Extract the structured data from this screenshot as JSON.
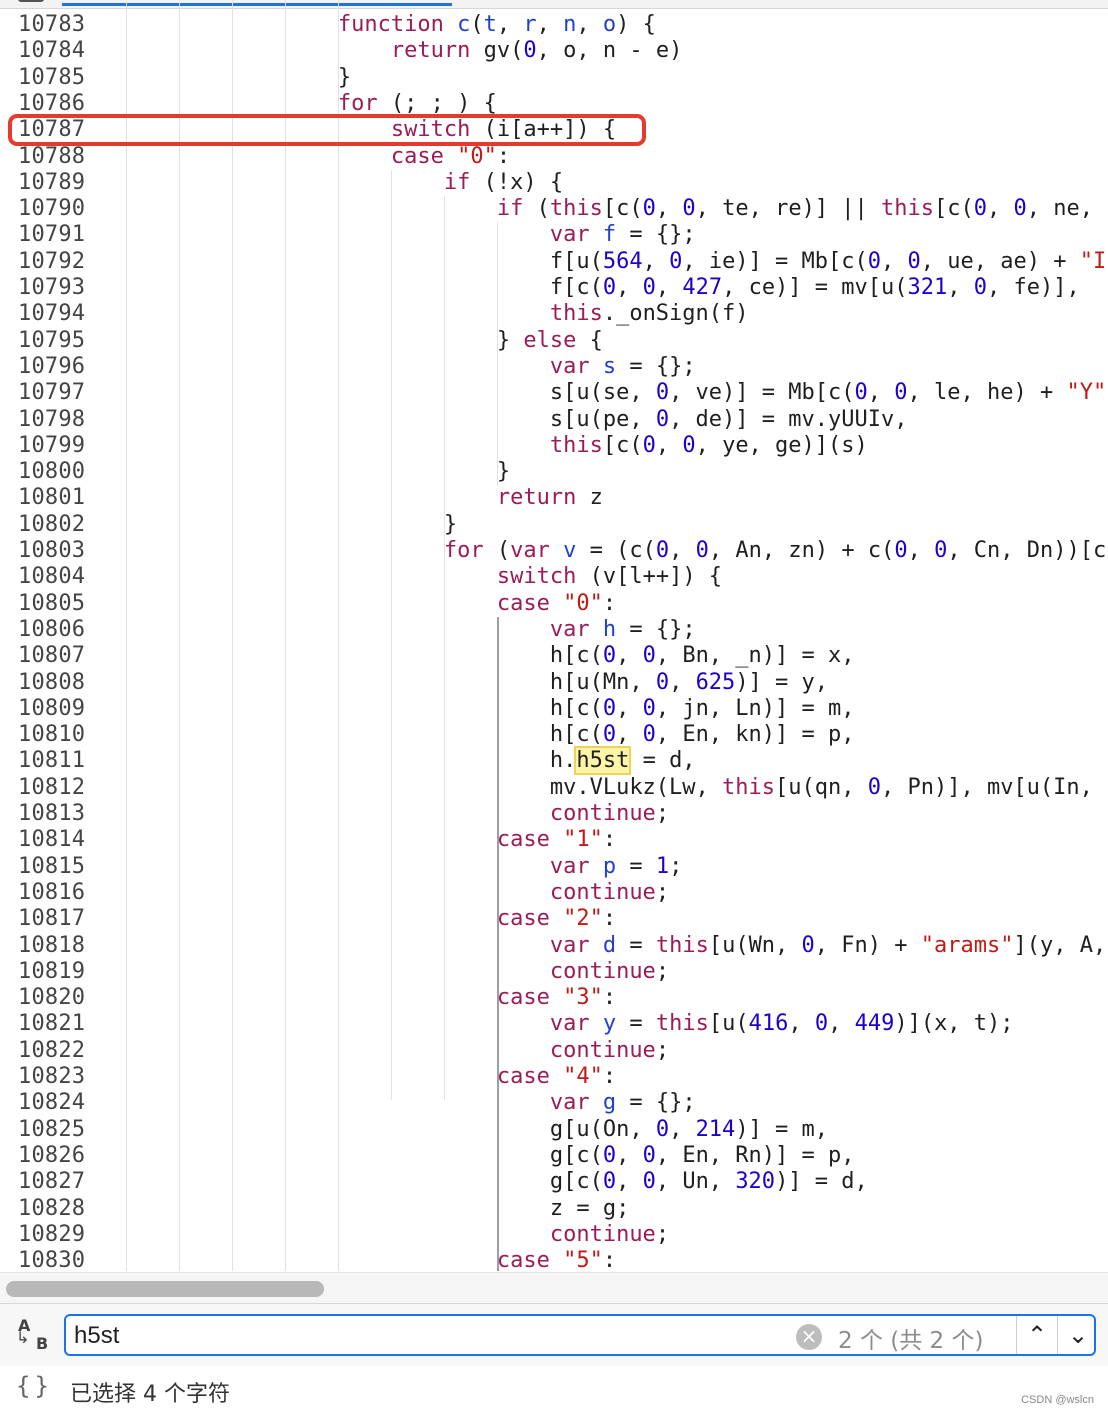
{
  "code_lines": [
    {
      "n": "10783",
      "segs": [
        [
          "                ",
          ""
        ],
        [
          "function",
          "kw2"
        ],
        [
          " ",
          ""
        ],
        [
          "c",
          "vn"
        ],
        [
          "(",
          ""
        ],
        [
          "t",
          "vn"
        ],
        [
          ", ",
          ""
        ],
        [
          "r",
          "vn"
        ],
        [
          ", ",
          ""
        ],
        [
          "n",
          "vn"
        ],
        [
          ", ",
          ""
        ],
        [
          "o",
          "vn"
        ],
        [
          ") {",
          ""
        ]
      ]
    },
    {
      "n": "10784",
      "segs": [
        [
          "                    ",
          ""
        ],
        [
          "return",
          "kw2"
        ],
        [
          " gv(",
          ""
        ],
        [
          "0",
          "num"
        ],
        [
          ", o, n - e)",
          ""
        ]
      ]
    },
    {
      "n": "10785",
      "segs": [
        [
          "                }",
          ""
        ]
      ]
    },
    {
      "n": "10786",
      "segs": [
        [
          "                ",
          ""
        ],
        [
          "for",
          "kw2"
        ],
        [
          " (; ; ) {",
          ""
        ]
      ]
    },
    {
      "n": "10787",
      "segs": [
        [
          "                    ",
          ""
        ],
        [
          "switch",
          "kw2"
        ],
        [
          " (i[a++]) {",
          ""
        ]
      ]
    },
    {
      "n": "10788",
      "segs": [
        [
          "                    ",
          ""
        ],
        [
          "case",
          "kw2"
        ],
        [
          " ",
          ""
        ],
        [
          "\"0\"",
          "str"
        ],
        [
          ":",
          ""
        ]
      ]
    },
    {
      "n": "10789",
      "segs": [
        [
          "                        ",
          ""
        ],
        [
          "if",
          "kw2"
        ],
        [
          " (!x) {",
          ""
        ]
      ]
    },
    {
      "n": "10790",
      "segs": [
        [
          "                            ",
          ""
        ],
        [
          "if",
          "kw2"
        ],
        [
          " (",
          ""
        ],
        [
          "this",
          "kw2"
        ],
        [
          "[c(",
          ""
        ],
        [
          "0",
          "num"
        ],
        [
          ", ",
          ""
        ],
        [
          "0",
          "num"
        ],
        [
          ", te, re)] || ",
          ""
        ],
        [
          "this",
          "kw2"
        ],
        [
          "[c(",
          ""
        ],
        [
          "0",
          "num"
        ],
        [
          ", ",
          ""
        ],
        [
          "0",
          "num"
        ],
        [
          ", ne,",
          ""
        ]
      ]
    },
    {
      "n": "10791",
      "segs": [
        [
          "                                ",
          ""
        ],
        [
          "var",
          "kw2"
        ],
        [
          " ",
          ""
        ],
        [
          "f",
          "vn"
        ],
        [
          " = {};",
          ""
        ]
      ]
    },
    {
      "n": "10792",
      "segs": [
        [
          "                                f[u(",
          ""
        ],
        [
          "564",
          "num"
        ],
        [
          ", ",
          ""
        ],
        [
          "0",
          "num"
        ],
        [
          ", ie)] = Mb[c(",
          ""
        ],
        [
          "0",
          "num"
        ],
        [
          ", ",
          ""
        ],
        [
          "0",
          "num"
        ],
        [
          ", ue, ae) + ",
          ""
        ],
        [
          "\"I",
          "str"
        ]
      ]
    },
    {
      "n": "10793",
      "segs": [
        [
          "                                f[c(",
          ""
        ],
        [
          "0",
          "num"
        ],
        [
          ", ",
          ""
        ],
        [
          "0",
          "num"
        ],
        [
          ", ",
          ""
        ],
        [
          "427",
          "num"
        ],
        [
          ", ce)] = mv[u(",
          ""
        ],
        [
          "321",
          "num"
        ],
        [
          ", ",
          ""
        ],
        [
          "0",
          "num"
        ],
        [
          ", fe)],",
          ""
        ]
      ]
    },
    {
      "n": "10794",
      "segs": [
        [
          "                                ",
          ""
        ],
        [
          "this",
          "kw2"
        ],
        [
          "._onSign(f)",
          ""
        ]
      ]
    },
    {
      "n": "10795",
      "segs": [
        [
          "                            } ",
          ""
        ],
        [
          "else",
          "kw2"
        ],
        [
          " {",
          ""
        ]
      ]
    },
    {
      "n": "10796",
      "segs": [
        [
          "                                ",
          ""
        ],
        [
          "var",
          "kw2"
        ],
        [
          " ",
          ""
        ],
        [
          "s",
          "vn"
        ],
        [
          " = {};",
          ""
        ]
      ]
    },
    {
      "n": "10797",
      "segs": [
        [
          "                                s[u(se, ",
          ""
        ],
        [
          "0",
          "num"
        ],
        [
          ", ve)] = Mb[c(",
          ""
        ],
        [
          "0",
          "num"
        ],
        [
          ", ",
          ""
        ],
        [
          "0",
          "num"
        ],
        [
          ", le, he) + ",
          ""
        ],
        [
          "\"Y\"",
          "str"
        ]
      ]
    },
    {
      "n": "10798",
      "segs": [
        [
          "                                s[u(pe, ",
          ""
        ],
        [
          "0",
          "num"
        ],
        [
          ", de)] = mv.yUUIv,",
          ""
        ]
      ]
    },
    {
      "n": "10799",
      "segs": [
        [
          "                                ",
          ""
        ],
        [
          "this",
          "kw2"
        ],
        [
          "[c(",
          ""
        ],
        [
          "0",
          "num"
        ],
        [
          ", ",
          ""
        ],
        [
          "0",
          "num"
        ],
        [
          ", ye, ge)](s)",
          ""
        ]
      ]
    },
    {
      "n": "10800",
      "segs": [
        [
          "                            }",
          ""
        ]
      ]
    },
    {
      "n": "10801",
      "segs": [
        [
          "                            ",
          ""
        ],
        [
          "return",
          "kw2"
        ],
        [
          " z",
          ""
        ]
      ]
    },
    {
      "n": "10802",
      "segs": [
        [
          "                        }",
          ""
        ]
      ]
    },
    {
      "n": "10803",
      "segs": [
        [
          "                        ",
          ""
        ],
        [
          "for",
          "kw2"
        ],
        [
          " (",
          ""
        ],
        [
          "var",
          "kw2"
        ],
        [
          " ",
          ""
        ],
        [
          "v",
          "vn"
        ],
        [
          " = (c(",
          ""
        ],
        [
          "0",
          "num"
        ],
        [
          ", ",
          ""
        ],
        [
          "0",
          "num"
        ],
        [
          ", An, zn) + c(",
          ""
        ],
        [
          "0",
          "num"
        ],
        [
          ", ",
          ""
        ],
        [
          "0",
          "num"
        ],
        [
          ", Cn, Dn))[c",
          ""
        ]
      ]
    },
    {
      "n": "10804",
      "segs": [
        [
          "                            ",
          ""
        ],
        [
          "switch",
          "kw2"
        ],
        [
          " (v[l++]) {",
          ""
        ]
      ]
    },
    {
      "n": "10805",
      "segs": [
        [
          "                            ",
          ""
        ],
        [
          "case",
          "kw2"
        ],
        [
          " ",
          ""
        ],
        [
          "\"0\"",
          "str"
        ],
        [
          ":",
          ""
        ]
      ]
    },
    {
      "n": "10806",
      "segs": [
        [
          "                                ",
          ""
        ],
        [
          "var",
          "kw2"
        ],
        [
          " ",
          ""
        ],
        [
          "h",
          "vn"
        ],
        [
          " = {};",
          ""
        ]
      ]
    },
    {
      "n": "10807",
      "segs": [
        [
          "                                h[c(",
          ""
        ],
        [
          "0",
          "num"
        ],
        [
          ", ",
          ""
        ],
        [
          "0",
          "num"
        ],
        [
          ", Bn, _n)] = x,",
          ""
        ]
      ]
    },
    {
      "n": "10808",
      "segs": [
        [
          "                                h[u(Mn, ",
          ""
        ],
        [
          "0",
          "num"
        ],
        [
          ", ",
          ""
        ],
        [
          "625",
          "num"
        ],
        [
          ")] = y,",
          ""
        ]
      ]
    },
    {
      "n": "10809",
      "segs": [
        [
          "                                h[c(",
          ""
        ],
        [
          "0",
          "num"
        ],
        [
          ", ",
          ""
        ],
        [
          "0",
          "num"
        ],
        [
          ", jn, Ln)] = m,",
          ""
        ]
      ]
    },
    {
      "n": "10810",
      "segs": [
        [
          "                                h[c(",
          ""
        ],
        [
          "0",
          "num"
        ],
        [
          ", ",
          ""
        ],
        [
          "0",
          "num"
        ],
        [
          ", En, kn)] = p,",
          ""
        ]
      ]
    },
    {
      "n": "10811",
      "segs": [
        [
          "                                h.",
          ""
        ],
        [
          "h5st",
          "hl"
        ],
        [
          " = d,",
          ""
        ]
      ]
    },
    {
      "n": "10812",
      "segs": [
        [
          "                                mv.VLukz(Lw, ",
          ""
        ],
        [
          "this",
          "kw2"
        ],
        [
          "[u(qn, ",
          ""
        ],
        [
          "0",
          "num"
        ],
        [
          ", Pn)], mv[u(In,",
          ""
        ]
      ]
    },
    {
      "n": "10813",
      "segs": [
        [
          "                                ",
          ""
        ],
        [
          "continue",
          "kw2"
        ],
        [
          ";",
          ""
        ]
      ]
    },
    {
      "n": "10814",
      "segs": [
        [
          "                            ",
          ""
        ],
        [
          "case",
          "kw2"
        ],
        [
          " ",
          ""
        ],
        [
          "\"1\"",
          "str"
        ],
        [
          ":",
          ""
        ]
      ]
    },
    {
      "n": "10815",
      "segs": [
        [
          "                                ",
          ""
        ],
        [
          "var",
          "kw2"
        ],
        [
          " ",
          ""
        ],
        [
          "p",
          "vn"
        ],
        [
          " = ",
          ""
        ],
        [
          "1",
          "num"
        ],
        [
          ";",
          ""
        ]
      ]
    },
    {
      "n": "10816",
      "segs": [
        [
          "                                ",
          ""
        ],
        [
          "continue",
          "kw2"
        ],
        [
          ";",
          ""
        ]
      ]
    },
    {
      "n": "10817",
      "segs": [
        [
          "                            ",
          ""
        ],
        [
          "case",
          "kw2"
        ],
        [
          " ",
          ""
        ],
        [
          "\"2\"",
          "str"
        ],
        [
          ":",
          ""
        ]
      ]
    },
    {
      "n": "10818",
      "segs": [
        [
          "                                ",
          ""
        ],
        [
          "var",
          "kw2"
        ],
        [
          " ",
          ""
        ],
        [
          "d",
          "vn"
        ],
        [
          " = ",
          ""
        ],
        [
          "this",
          "kw2"
        ],
        [
          "[u(Wn, ",
          ""
        ],
        [
          "0",
          "num"
        ],
        [
          ", Fn) + ",
          ""
        ],
        [
          "\"arams\"",
          "str"
        ],
        [
          "](y, A,",
          ""
        ]
      ]
    },
    {
      "n": "10819",
      "segs": [
        [
          "                                ",
          ""
        ],
        [
          "continue",
          "kw2"
        ],
        [
          ";",
          ""
        ]
      ]
    },
    {
      "n": "10820",
      "segs": [
        [
          "                            ",
          ""
        ],
        [
          "case",
          "kw2"
        ],
        [
          " ",
          ""
        ],
        [
          "\"3\"",
          "str"
        ],
        [
          ":",
          ""
        ]
      ]
    },
    {
      "n": "10821",
      "segs": [
        [
          "                                ",
          ""
        ],
        [
          "var",
          "kw2"
        ],
        [
          " ",
          ""
        ],
        [
          "y",
          "vn"
        ],
        [
          " = ",
          ""
        ],
        [
          "this",
          "kw2"
        ],
        [
          "[u(",
          ""
        ],
        [
          "416",
          "num"
        ],
        [
          ", ",
          ""
        ],
        [
          "0",
          "num"
        ],
        [
          ", ",
          ""
        ],
        [
          "449",
          "num"
        ],
        [
          ")](x, t);",
          ""
        ]
      ]
    },
    {
      "n": "10822",
      "segs": [
        [
          "                                ",
          ""
        ],
        [
          "continue",
          "kw2"
        ],
        [
          ";",
          ""
        ]
      ]
    },
    {
      "n": "10823",
      "segs": [
        [
          "                            ",
          ""
        ],
        [
          "case",
          "kw2"
        ],
        [
          " ",
          ""
        ],
        [
          "\"4\"",
          "str"
        ],
        [
          ":",
          ""
        ]
      ]
    },
    {
      "n": "10824",
      "segs": [
        [
          "                                ",
          ""
        ],
        [
          "var",
          "kw2"
        ],
        [
          " ",
          ""
        ],
        [
          "g",
          "vn"
        ],
        [
          " = {};",
          ""
        ]
      ]
    },
    {
      "n": "10825",
      "segs": [
        [
          "                                g[u(On, ",
          ""
        ],
        [
          "0",
          "num"
        ],
        [
          ", ",
          ""
        ],
        [
          "214",
          "num"
        ],
        [
          ")] = m,",
          ""
        ]
      ]
    },
    {
      "n": "10826",
      "segs": [
        [
          "                                g[c(",
          ""
        ],
        [
          "0",
          "num"
        ],
        [
          ", ",
          ""
        ],
        [
          "0",
          "num"
        ],
        [
          ", En, Rn)] = p,",
          ""
        ]
      ]
    },
    {
      "n": "10827",
      "segs": [
        [
          "                                g[c(",
          ""
        ],
        [
          "0",
          "num"
        ],
        [
          ", ",
          ""
        ],
        [
          "0",
          "num"
        ],
        [
          ", Un, ",
          ""
        ],
        [
          "320",
          "num"
        ],
        [
          ")] = d,",
          ""
        ]
      ]
    },
    {
      "n": "10828",
      "segs": [
        [
          "                                z = g;",
          ""
        ]
      ]
    },
    {
      "n": "10829",
      "segs": [
        [
          "                                ",
          ""
        ],
        [
          "continue",
          "kw2"
        ],
        [
          ";",
          ""
        ]
      ]
    },
    {
      "n": "10830",
      "segs": [
        [
          "                            ",
          ""
        ],
        [
          "case",
          "kw2"
        ],
        [
          " ",
          ""
        ],
        [
          "\"5\"",
          "str"
        ],
        [
          ":",
          ""
        ]
      ]
    }
  ],
  "find": {
    "query": "h5st",
    "match_count": "2 个 (共 2 个)",
    "case_icon": "match-case-icon",
    "clear_icon": "clear-icon",
    "prev_icon": "chevron-up-icon",
    "next_icon": "chevron-down-icon",
    "prev_glyph": "⌃",
    "next_glyph": "⌄"
  },
  "status": {
    "braces": "{}",
    "selection": "已选择 4 个字符",
    "watermark": "CSDN @wslcn"
  },
  "colors": {
    "keyword": "#9c1c56",
    "number": "#1c00cf",
    "string": "#c41a16",
    "variable": "#2142c8",
    "highlight_border": "#e53b2c",
    "find_focus": "#1a73e8"
  }
}
